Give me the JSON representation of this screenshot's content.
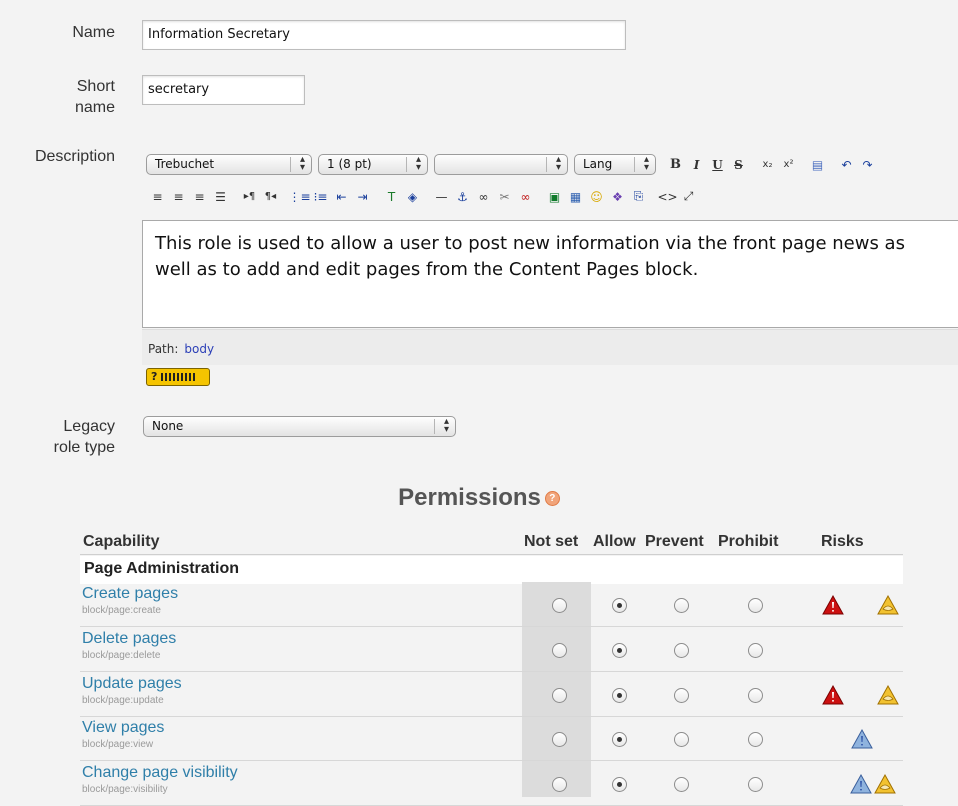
{
  "form": {
    "name_label": "Name",
    "name_value": "Information Secretary",
    "short_label_1": "Short",
    "short_label_2": "name",
    "short_value": "secretary",
    "description_label": "Description",
    "legacy_label_1": "Legacy",
    "legacy_label_2": "role type",
    "legacy_value": "None"
  },
  "editor": {
    "font_family": "Trebuchet",
    "font_size": "1 (8 pt)",
    "format": "",
    "lang": "Lang",
    "content": "This role is used to allow a user to post new information via the front page news as well as to add and edit pages from the Content Pages block.",
    "path_label": "Path:",
    "path_value": "body",
    "help_label": "?"
  },
  "permissions": {
    "title": "Permissions",
    "headers": {
      "capability": "Capability",
      "not_set": "Not set",
      "allow": "Allow",
      "prevent": "Prevent",
      "prohibit": "Prohibit",
      "risks": "Risks"
    },
    "section": "Page Administration",
    "rows": [
      {
        "name": "Create pages",
        "id": "block/page:create",
        "selected": "allow",
        "risks": [
          "red",
          "yellow"
        ]
      },
      {
        "name": "Delete pages",
        "id": "block/page:delete",
        "selected": "allow",
        "risks": []
      },
      {
        "name": "Update pages",
        "id": "block/page:update",
        "selected": "allow",
        "risks": [
          "red",
          "yellow"
        ]
      },
      {
        "name": "View pages",
        "id": "block/page:view",
        "selected": "allow",
        "risks": [
          "blue"
        ]
      },
      {
        "name": "Change page visibility",
        "id": "block/page:visibility",
        "selected": "allow",
        "risks": [
          "blue",
          "yellow"
        ]
      }
    ]
  },
  "colors": {
    "link": "#2f7fa9",
    "risk_red": "#cc1010",
    "risk_yellow": "#f2c230",
    "risk_blue": "#8fb3de"
  }
}
